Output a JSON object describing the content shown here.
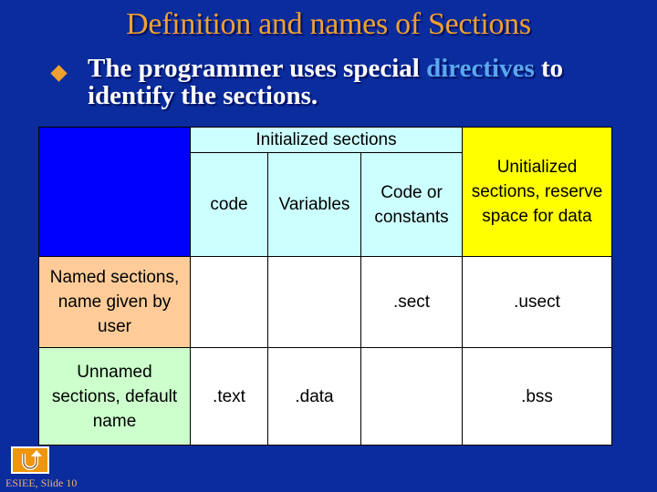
{
  "slide": {
    "title": "Definition and names of Sections",
    "bullet": {
      "icon": "diamond-bullet-icon",
      "text_before": "The programmer uses special ",
      "highlight": "directives",
      "text_after": " to identify the sections."
    },
    "table": {
      "header": {
        "initialized_group": "Initialized sections",
        "uninitialized": "Unitialized sections, reserve space for data",
        "columns": [
          "code",
          "Variables",
          "Code or constants"
        ]
      },
      "rows": [
        {
          "label": "Named sections, name given by user",
          "cells": [
            "",
            "",
            ".sect",
            ".usect"
          ]
        },
        {
          "label": "Unnamed sections, default name",
          "cells": [
            ".text",
            ".data",
            "",
            ".bss"
          ]
        }
      ]
    },
    "logo_icon": "return-arrow-icon",
    "footer": "ESIEE, Slide 10",
    "colors": {
      "background": "#0a2c9c",
      "title": "#f0a030",
      "highlight": "#5aa8f0",
      "initialized": "#ccffff",
      "uninitialized": "#ffff00",
      "named": "#ffcc99",
      "unnamed": "#ccffcc"
    }
  }
}
